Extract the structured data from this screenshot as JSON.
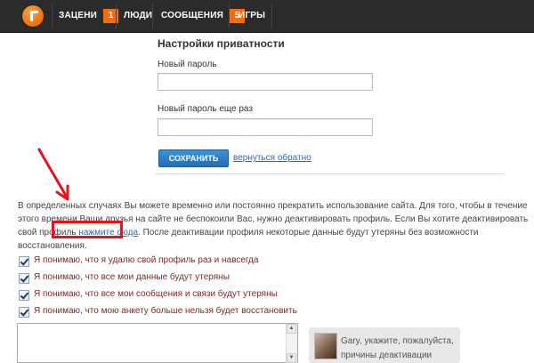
{
  "nav": {
    "items": [
      {
        "label": "ЗАЦЕНИ",
        "badge": "1"
      },
      {
        "label": "ЛЮДИ"
      },
      {
        "label": "СООБЩЕНИЯ",
        "badge": "5"
      },
      {
        "label": "ИГРЫ"
      }
    ]
  },
  "settings": {
    "title": "Настройки приватности",
    "new_password_label": "Новый пароль",
    "new_password_value": "",
    "repeat_password_label": "Новый пароль еще раз",
    "repeat_password_value": "",
    "save_label": "СОХРАНИТЬ",
    "back_label": "вернуться обратно"
  },
  "deactivation": {
    "text_before_link": "В определенных случаях Вы можете временно или постоянно прекратить использование сайта. Для того, чтобы в течение этого времени Ваши друзья на сайте не беспокоили Вас, нужно деактивировать профиль. Если Вы хотите деактивировать свой профиль ",
    "link_label": "нажмите сюда",
    "text_after_link": ". После деактивации профиля некоторые данные будут утеряны без возможности восстановления."
  },
  "checks": [
    {
      "label": "Я понимаю, что я удалю свой профиль раз и навсегда",
      "checked": true
    },
    {
      "label": "Я понимаю, что все мои данные будут утеряны",
      "checked": true
    },
    {
      "label": "Я понимаю, что все мои сообщения и связи будут утеряны",
      "checked": true
    },
    {
      "label": "Я понимаю, что мою анкету больше нельзя будет восстановить",
      "checked": true
    }
  ],
  "reason": {
    "value": "",
    "hint": "Gary, укажите, пожалуйста, причины деактивации"
  },
  "colors": {
    "accent": "#f26d12",
    "topbar": "#2b2b2b",
    "button": "#1f6db5",
    "link": "#2a6ab0",
    "annotation": "#e4131e"
  }
}
